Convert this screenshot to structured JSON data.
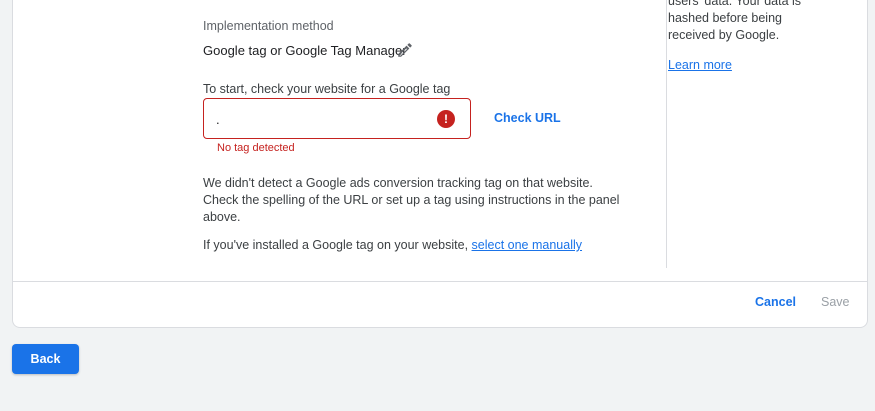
{
  "side_panel": {
    "text_lines": [
      "users' data. Your data is",
      "hashed before being",
      "received by Google."
    ],
    "learn_more": "Learn more"
  },
  "implementation": {
    "label": "Implementation method",
    "value": "Google tag or Google Tag Manager",
    "edit_icon": "pencil-icon"
  },
  "url_check": {
    "prompt": "To start, check your website for a Google tag",
    "input_value": ".",
    "error_icon": "error-icon",
    "error_text": "No tag detected",
    "check_button": "Check URL"
  },
  "message": {
    "line1": "We didn't detect a Google ads conversion tracking tag on that website.",
    "line2": "Check the spelling of the URL or set up a tag using instructions in the panel",
    "line3": "above.",
    "manual_prefix": "If you've installed a Google tag on your website, ",
    "manual_link": "select one manually"
  },
  "footer": {
    "cancel": "Cancel",
    "save": "Save"
  },
  "back_button": "Back",
  "colors": {
    "accent": "#1a73e8",
    "error": "#c5221f",
    "disabled": "#9aa0a6"
  }
}
